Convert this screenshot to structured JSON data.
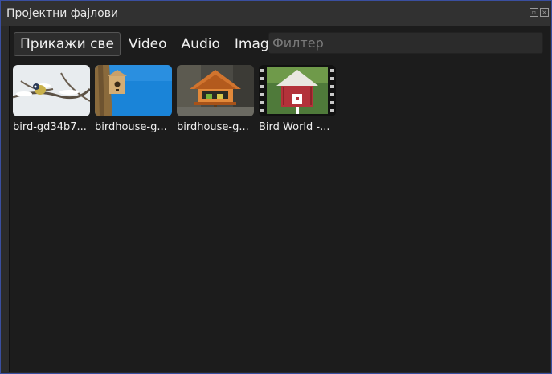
{
  "window": {
    "title": "Пројектни фајлови"
  },
  "tabs": [
    {
      "label": "Прикажи све",
      "active": true
    },
    {
      "label": "Video",
      "active": false
    },
    {
      "label": "Audio",
      "active": false
    },
    {
      "label": "Image",
      "active": false
    }
  ],
  "filter": {
    "placeholder": "Филтер",
    "value": ""
  },
  "files": [
    {
      "name": "bird-gd34b7...",
      "type": "image"
    },
    {
      "name": "birdhouse-g...",
      "type": "image"
    },
    {
      "name": "birdhouse-g...",
      "type": "image"
    },
    {
      "name": "Bird World -...",
      "type": "video"
    }
  ]
}
